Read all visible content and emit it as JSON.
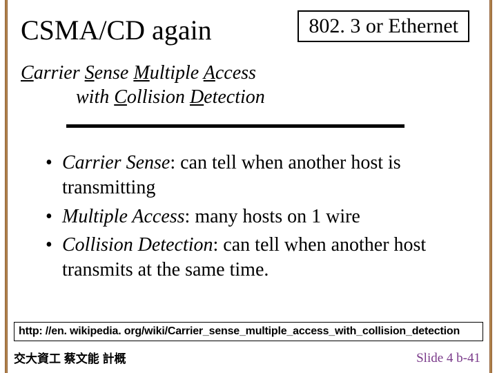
{
  "title": "CSMA/CD again",
  "box_label": "802. 3 or Ethernet",
  "subtitle": {
    "c": "C",
    "arrier": "arrier ",
    "s": "S",
    "ense": "ense ",
    "m": "M",
    "ultiple": "ultiple ",
    "a": "A",
    "ccess": "ccess",
    "line2_prefix": "with   ",
    "cd_c": "C",
    "cd_o": "ollision ",
    "cd_d": "D",
    "cd_e": "etection"
  },
  "bullets": [
    {
      "term": "Carrier Sense",
      "rest": ": can tell when another host is transmitting"
    },
    {
      "term": "Multiple Access",
      "rest": ": many hosts on 1 wire"
    },
    {
      "term": "Collision Detection",
      "rest": ": can tell when another host transmits at the same time."
    }
  ],
  "url": "http: //en. wikipedia. org/wiki/Carrier_sense_multiple_access_with_collision_detection",
  "footer_left": "交大資工 蔡文能 計概",
  "footer_right": "Slide 4 b-41"
}
